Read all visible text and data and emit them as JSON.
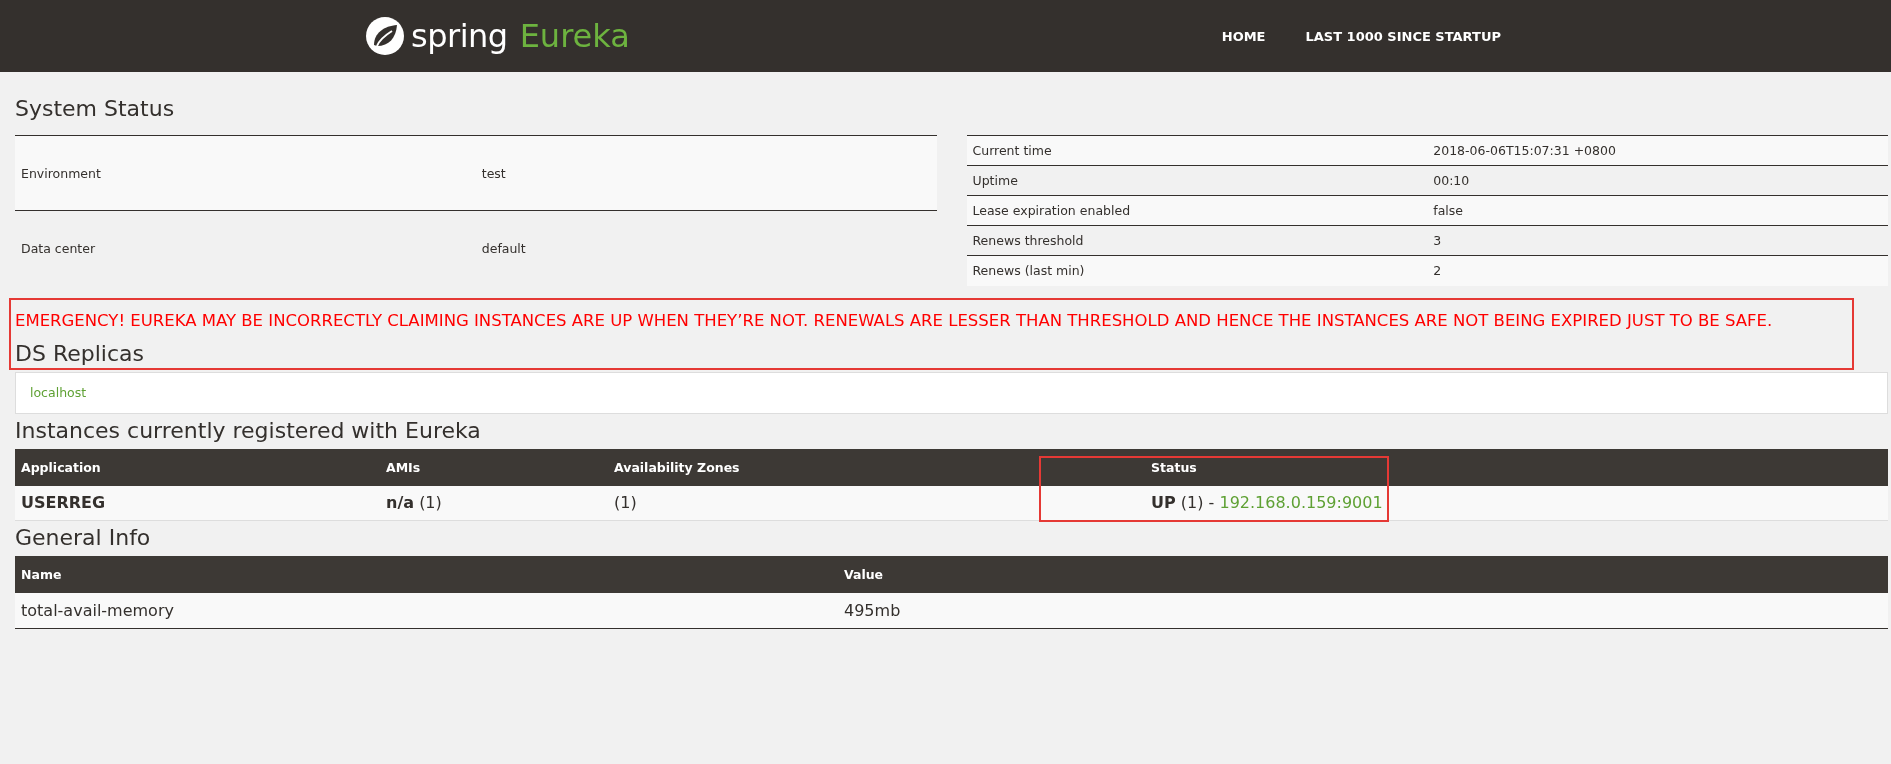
{
  "navbar": {
    "brand": "spring",
    "product": "Eureka",
    "links": [
      "HOME",
      "LAST 1000 SINCE STARTUP"
    ]
  },
  "system_status": {
    "title": "System Status",
    "left": [
      {
        "name": "Environment",
        "value": "test"
      },
      {
        "name": "Data center",
        "value": "default"
      }
    ],
    "right": [
      {
        "name": "Current time",
        "value": "2018-06-06T15:07:31 +0800"
      },
      {
        "name": "Uptime",
        "value": "00:10"
      },
      {
        "name": "Lease expiration enabled",
        "value": "false"
      },
      {
        "name": "Renews threshold",
        "value": "3"
      },
      {
        "name": "Renews (last min)",
        "value": "2"
      }
    ]
  },
  "emergency": {
    "message": "EMERGENCY! EUREKA MAY BE INCORRECTLY CLAIMING INSTANCES ARE UP WHEN THEY’RE NOT. RENEWALS ARE LESSER THAN THRESHOLD AND HENCE THE INSTANCES ARE NOT BEING EXPIRED JUST TO BE SAFE.",
    "highlighted": true
  },
  "ds_replicas": {
    "title": "DS Replicas",
    "items": [
      "localhost"
    ]
  },
  "instances": {
    "title": "Instances currently registered with Eureka",
    "columns": [
      "Application",
      "AMIs",
      "Availability Zones",
      "Status"
    ],
    "rows": [
      {
        "application": "USERREG",
        "amis": "n/a",
        "amis_count": "(1)",
        "zones": "(1)",
        "status": "UP",
        "status_count": "(1)",
        "separator": "-",
        "instance_link": "192.168.0.159:9001",
        "status_highlighted": true
      }
    ]
  },
  "general_info": {
    "title": "General Info",
    "columns": [
      "Name",
      "Value"
    ],
    "rows": [
      {
        "name": "total-avail-memory",
        "value": "495mb"
      }
    ]
  }
}
